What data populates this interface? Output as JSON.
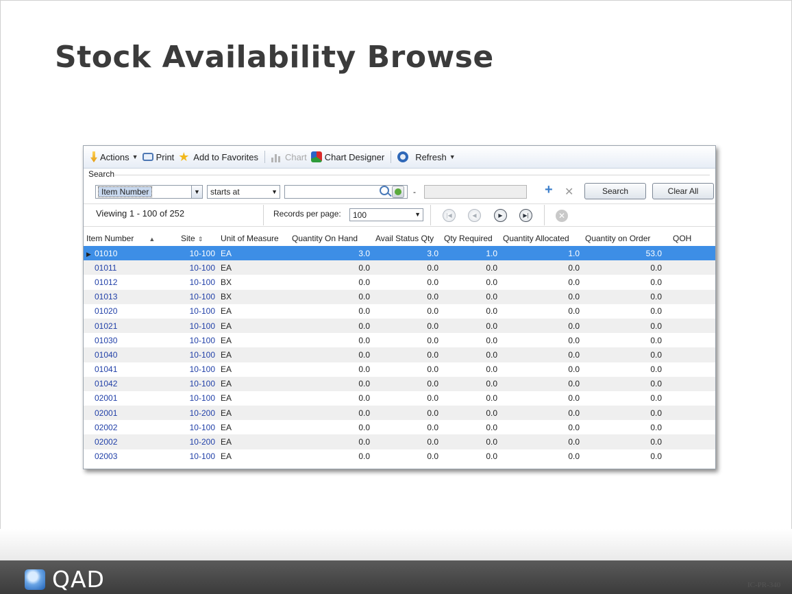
{
  "slide": {
    "title": "Stock Availability Browse",
    "logo_text": "QAD",
    "doc_code": "IC-PR-340"
  },
  "toolbar": {
    "actions_label": "Actions",
    "print_label": "Print",
    "favorites_label": "Add to Favorites",
    "chart_label": "Chart",
    "chart_designer_label": "Chart Designer",
    "refresh_label": "Refresh"
  },
  "search": {
    "section_label": "Search",
    "field_value": "Item Number",
    "operator_value": "starts at",
    "value_input": "",
    "range_dash": "-",
    "search_button": "Search",
    "clear_button": "Clear All"
  },
  "paging": {
    "viewing_text": "Viewing 1 - 100 of 252",
    "records_per_page_label": "Records per page:",
    "records_per_page_value": "100"
  },
  "grid": {
    "columns": [
      "Item Number",
      "Site",
      "Unit of Measure",
      "Quantity On Hand",
      "Avail Status Qty",
      "Qty Required",
      "Quantity Allocated",
      "Quantity on Order",
      "QOH"
    ],
    "rows": [
      [
        "01010",
        "10-100",
        "EA",
        "3.0",
        "3.0",
        "1.0",
        "1.0",
        "53.0"
      ],
      [
        "01011",
        "10-100",
        "EA",
        "0.0",
        "0.0",
        "0.0",
        "0.0",
        "0.0"
      ],
      [
        "01012",
        "10-100",
        "BX",
        "0.0",
        "0.0",
        "0.0",
        "0.0",
        "0.0"
      ],
      [
        "01013",
        "10-100",
        "BX",
        "0.0",
        "0.0",
        "0.0",
        "0.0",
        "0.0"
      ],
      [
        "01020",
        "10-100",
        "EA",
        "0.0",
        "0.0",
        "0.0",
        "0.0",
        "0.0"
      ],
      [
        "01021",
        "10-100",
        "EA",
        "0.0",
        "0.0",
        "0.0",
        "0.0",
        "0.0"
      ],
      [
        "01030",
        "10-100",
        "EA",
        "0.0",
        "0.0",
        "0.0",
        "0.0",
        "0.0"
      ],
      [
        "01040",
        "10-100",
        "EA",
        "0.0",
        "0.0",
        "0.0",
        "0.0",
        "0.0"
      ],
      [
        "01041",
        "10-100",
        "EA",
        "0.0",
        "0.0",
        "0.0",
        "0.0",
        "0.0"
      ],
      [
        "01042",
        "10-100",
        "EA",
        "0.0",
        "0.0",
        "0.0",
        "0.0",
        "0.0"
      ],
      [
        "02001",
        "10-100",
        "EA",
        "0.0",
        "0.0",
        "0.0",
        "0.0",
        "0.0"
      ],
      [
        "02001",
        "10-200",
        "EA",
        "0.0",
        "0.0",
        "0.0",
        "0.0",
        "0.0"
      ],
      [
        "02002",
        "10-100",
        "EA",
        "0.0",
        "0.0",
        "0.0",
        "0.0",
        "0.0"
      ],
      [
        "02002",
        "10-200",
        "EA",
        "0.0",
        "0.0",
        "0.0",
        "0.0",
        "0.0"
      ],
      [
        "02003",
        "10-100",
        "EA",
        "0.0",
        "0.0",
        "0.0",
        "0.0",
        "0.0"
      ]
    ],
    "selected_row": 0
  },
  "colors": {
    "selection": "#3d8ee6",
    "link": "#2140a8",
    "alt_row": "#efefef"
  },
  "icons": [
    "actions-icon",
    "print-icon",
    "star-icon",
    "chart-icon",
    "chart-designer-icon",
    "refresh-icon",
    "lookup-icon",
    "go-icon",
    "add-icon",
    "remove-icon",
    "first-page-icon",
    "prev-page-icon",
    "next-page-icon",
    "last-page-icon",
    "cancel-icon"
  ]
}
